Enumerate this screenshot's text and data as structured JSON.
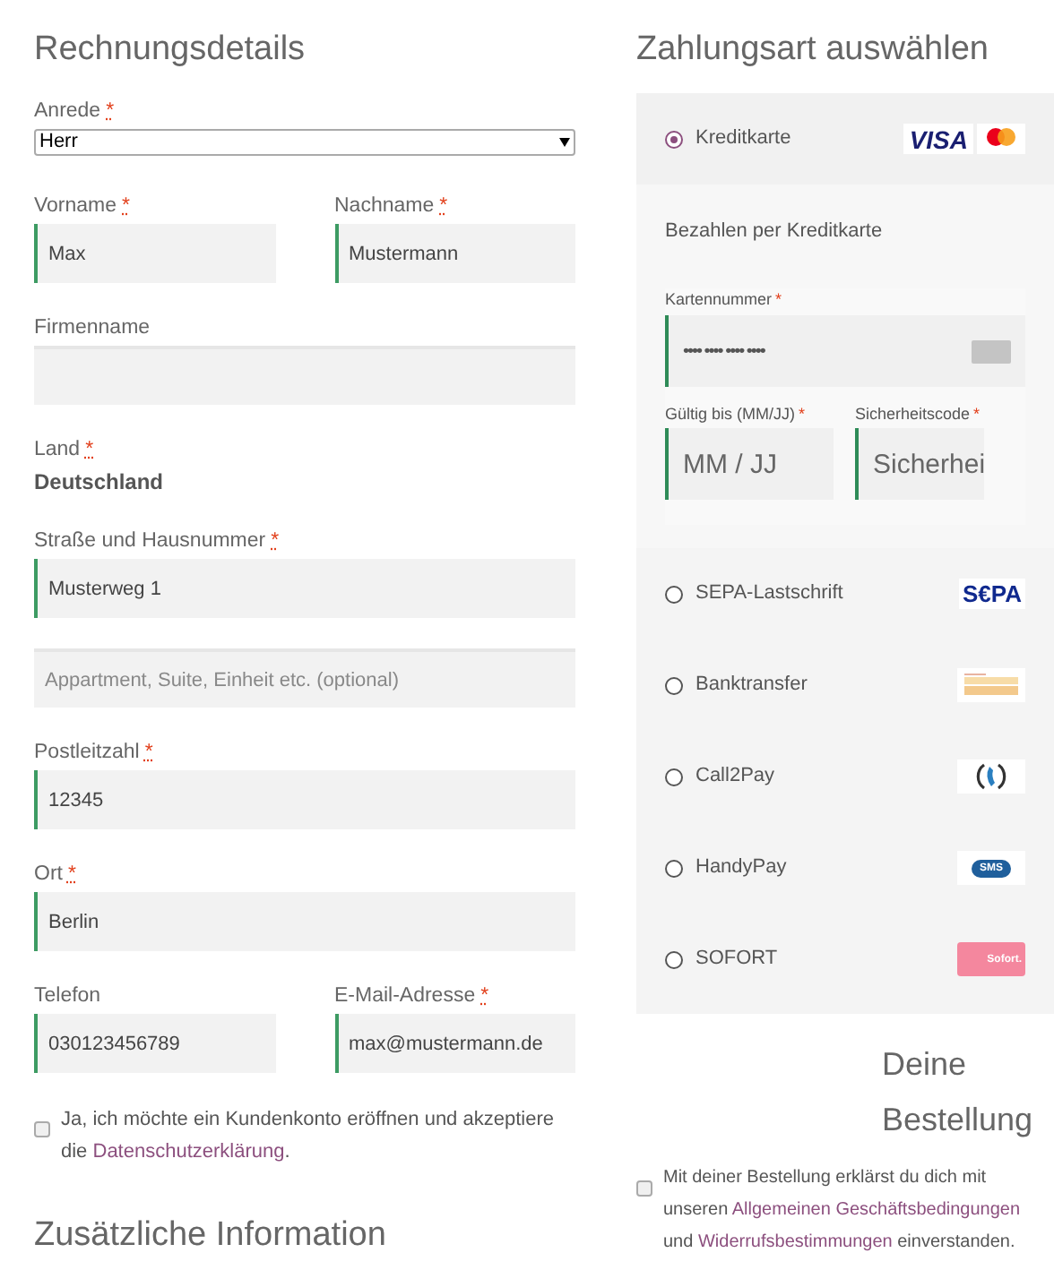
{
  "billing": {
    "title": "Rechnungsdetails",
    "salutation": {
      "label": "Anrede",
      "required_mark": "*",
      "value": "Herr"
    },
    "rows": [
      {
        "fields": [
          {
            "label": "Vorname",
            "required_mark": "*",
            "value": "Max",
            "validated": true
          },
          {
            "label": "Nachname",
            "required_mark": "*",
            "value": "Mustermann",
            "validated": true
          }
        ]
      },
      {
        "fields": [
          {
            "label": "Firmenname",
            "validated": false
          }
        ]
      },
      {
        "kind": "static",
        "label": "Land",
        "required_mark": "*",
        "value": "Deutschland"
      },
      {
        "fields": [
          {
            "label": "Straße und Hausnummer",
            "required_mark": "*",
            "value": "Musterweg 1",
            "validated": true
          }
        ]
      },
      {
        "fields": [
          {
            "placeholder": "Appartment, Suite, Einheit etc. (optional)",
            "validated": false
          }
        ]
      },
      {
        "fields": [
          {
            "label": "Postleitzahl",
            "required_mark": "*",
            "value": "12345",
            "validated": true
          }
        ]
      },
      {
        "fields": [
          {
            "label": "Ort",
            "required_mark": "*",
            "value": "Berlin",
            "validated": true
          }
        ]
      },
      {
        "fields": [
          {
            "label": "Telefon",
            "value": "030123456789",
            "validated": true
          },
          {
            "label": "E-Mail-Adresse",
            "required_mark": "*",
            "value": "max@mustermann.de",
            "validated": true
          }
        ]
      }
    ],
    "account_consent": {
      "checked": false,
      "parts": [
        {
          "kind": "text",
          "text": "Ja, ich möchte ein Kundenkonto eröffnen und akzeptiere die "
        },
        {
          "kind": "link",
          "text": "Datenschutzerklärung"
        },
        {
          "kind": "text",
          "text": "."
        }
      ]
    }
  },
  "additional": {
    "title": "Zusätzliche Information"
  },
  "payment": {
    "title": "Zahlungsart auswählen",
    "methods": [
      {
        "name": "Kreditkarte",
        "selected": true,
        "kind": "card",
        "logo_text": "VISA"
      },
      {
        "name": "SEPA-Lastschrift",
        "selected": false,
        "kind": "sepa",
        "logo_text": "S€PA"
      },
      {
        "name": "Banktransfer",
        "selected": false,
        "kind": "bank"
      },
      {
        "name": "Call2Pay",
        "selected": false,
        "kind": "phone"
      },
      {
        "name": "HandyPay",
        "selected": false,
        "kind": "sms",
        "logo_text": "SMS"
      },
      {
        "name": "SOFORT",
        "selected": false,
        "kind": "sofort",
        "logo_text": "Sofort."
      }
    ],
    "card_form": {
      "description": "Bezahlen per Kreditkarte",
      "number": {
        "label": "Kartennummer",
        "required_mark": "*",
        "value": "•••• •••• •••• ••••"
      },
      "expiry": {
        "label": "Gültig bis (MM/JJ)",
        "required_mark": "*",
        "placeholder": "MM / JJ"
      },
      "cvc": {
        "label": "Sicherheitscode",
        "required_mark": "*",
        "placeholder": "Sicherhei"
      }
    }
  },
  "order": {
    "title": "Deine Bestellung",
    "terms_consent": {
      "checked": false,
      "parts": [
        {
          "kind": "text",
          "text": "Mit deiner Bestellung erklärst du dich mit unseren "
        },
        {
          "kind": "link",
          "text": "Allgemeinen Geschäftsbedingungen"
        },
        {
          "kind": "text",
          "text": " und "
        },
        {
          "kind": "link",
          "text": "Widerrufsbestimmungen"
        },
        {
          "kind": "text",
          "text": " einverstanden."
        }
      ]
    }
  }
}
